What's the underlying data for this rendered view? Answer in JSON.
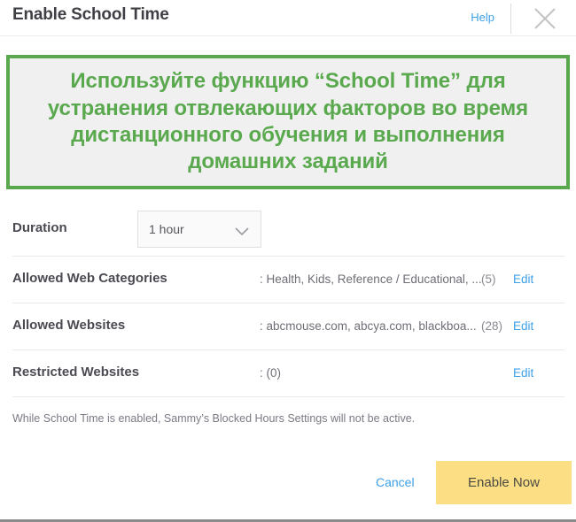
{
  "header": {
    "title": "Enable School Time",
    "help_label": "Help",
    "close_icon": "close-x-icon"
  },
  "banner": {
    "text": "Используйте функцию “School Time” для устранения отвлекающих факторов во время дистанционного обучения и выполнения домашних заданий",
    "border_color": "#59a84d",
    "text_color": "#5aa94e",
    "background_color": "#f0f0f0"
  },
  "duration": {
    "label": "Duration",
    "selected_value": "1 hour",
    "chevron_icon": "chevron-down-icon"
  },
  "settings_rows": [
    {
      "label": "Allowed Web Categories",
      "value": ": Health, Kids, Reference / Educational, ...",
      "count": "(5)",
      "edit_label": "Edit"
    },
    {
      "label": "Allowed Websites",
      "value": ": abcmouse.com, abcya.com, blackboa...",
      "count": "(28)",
      "edit_label": "Edit"
    },
    {
      "label": "Restricted Websites",
      "value": ": (0)",
      "count": "",
      "edit_label": "Edit"
    }
  ],
  "note": "While School Time is enabled, Sammy’s Blocked Hours Settings will not be active.",
  "footer": {
    "cancel_label": "Cancel",
    "enable_label": "Enable Now",
    "enable_color": "#fcde84",
    "link_color": "#3ca0e7"
  }
}
